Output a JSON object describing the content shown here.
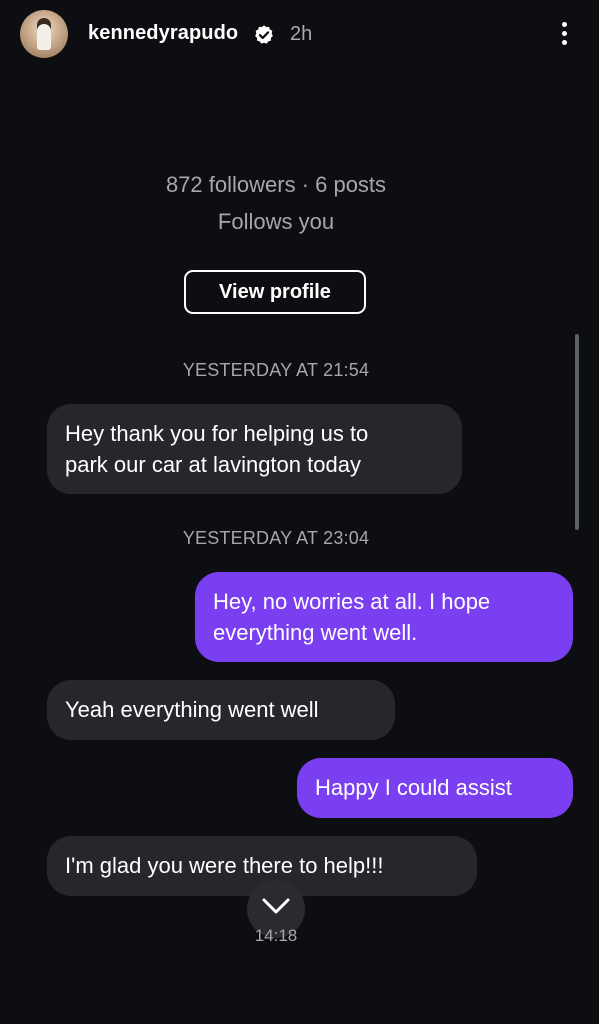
{
  "header": {
    "username": "kennedyrapudo",
    "time_ago": "2h",
    "verified_icon": "verified-badge-icon",
    "more_icon": "more-vertical-icon"
  },
  "profile": {
    "stats": "872 followers · 6 posts",
    "follows_you": "Follows you",
    "view_profile_label": "View profile"
  },
  "messages": [
    {
      "type": "timestamp",
      "text": "YESTERDAY AT 21:54"
    },
    {
      "type": "incoming",
      "lines": [
        "Hey thank you for helping us to",
        "park our car at lavington today"
      ]
    },
    {
      "type": "timestamp",
      "text": "YESTERDAY AT 23:04"
    },
    {
      "type": "outgoing",
      "lines": [
        "Hey, no worries at all. I hope",
        "everything went well."
      ]
    },
    {
      "type": "incoming",
      "lines": [
        "Yeah everything went well"
      ]
    },
    {
      "type": "outgoing",
      "lines": [
        "Happy I could assist"
      ]
    },
    {
      "type": "incoming",
      "lines": [
        "I'm glad you were there to help!!!"
      ]
    }
  ],
  "footer": {
    "scroll_down_icon": "chevron-down-icon",
    "message_time": "14:18"
  },
  "colors": {
    "background": "#0d0e12",
    "incoming_bubble": "#26272d",
    "outgoing_bubble": "#7b3ff2",
    "muted_text": "#a6a7ad"
  }
}
